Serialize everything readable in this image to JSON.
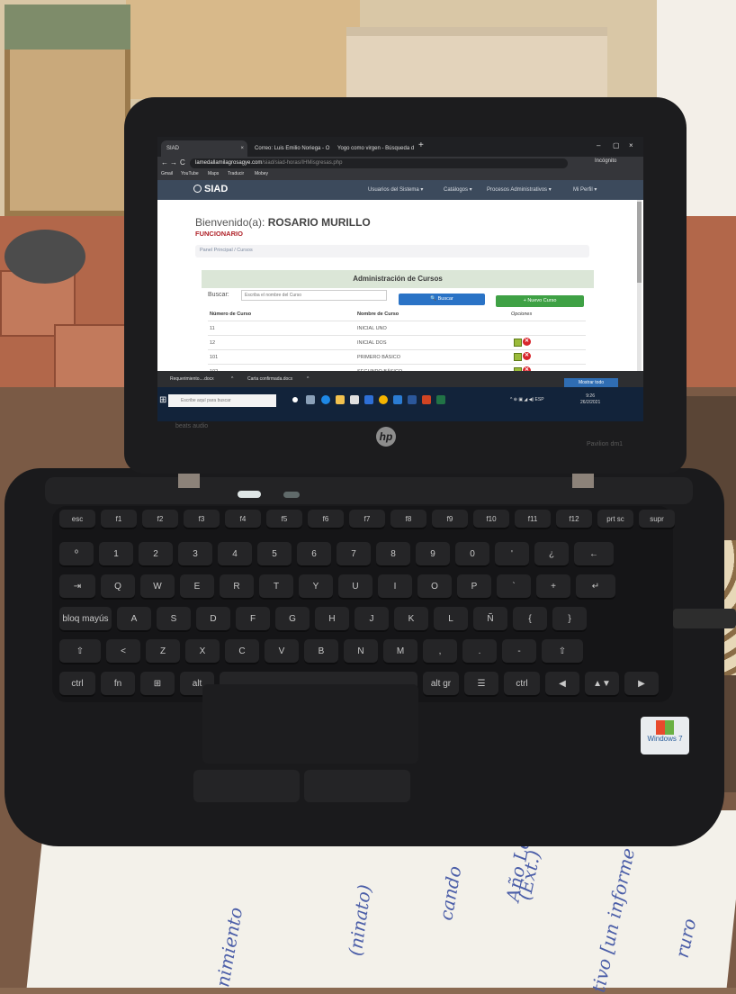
{
  "browser": {
    "tabs": [
      {
        "label": "SIAD",
        "close": "×"
      },
      {
        "label": "Correo: Luis Emilio Noriega - O",
        "close": "×"
      },
      {
        "label": "Yogo como virgen - Búsqueda d",
        "close": "×"
      }
    ],
    "new_tab": "+",
    "window_controls": {
      "minimize": "–",
      "maximize": "▢",
      "close": "×"
    },
    "nav": {
      "back": "←",
      "forward": "→",
      "reload": "C"
    },
    "url_host": "lamedallamilagrosagye.com",
    "url_path": "/siad/siad-horas/IHMisgresas.php",
    "profile_label": "Incógnito",
    "bookmarks": [
      "Gmail",
      "YouTube",
      "Maps",
      "Traducir",
      "Mobey"
    ]
  },
  "site": {
    "brand": "SIAD",
    "menu": [
      "Usuarios del Sistema ▾",
      "Catálogos ▾",
      "Procesos Administrativos ▾",
      "Mi Perfil ▾"
    ],
    "welcome_prefix": "Bienvenido(a):",
    "user_name": "ROSARIO MURILLO",
    "role": "FUNCIONARIO",
    "breadcrumb": "Panel Principal / Cursos",
    "panel_title": "Administración de Cursos",
    "search_label": "Buscar:",
    "search_placeholder": "Escriba el nombre del Curso",
    "search_button": "🔍 Buscar",
    "new_button": "+ Nuevo Curso",
    "columns": [
      "Número de Curso",
      "Nombre de Curso",
      "Opciones"
    ],
    "rows": [
      {
        "num": "11",
        "name": "INICIAL UNO"
      },
      {
        "num": "12",
        "name": "INICIAL DOS"
      },
      {
        "num": "101",
        "name": "PRIMERO BÁSICO"
      },
      {
        "num": "102",
        "name": "SEGUNDO BÁSICO"
      }
    ],
    "delete_glyph": "✕"
  },
  "downloads": [
    {
      "label": "Requerimiento....docx",
      "caret": "^"
    },
    {
      "label": "Carta confirmada.docx",
      "caret": "^"
    }
  ],
  "taskbar": {
    "start": "⊞",
    "search_placeholder": "Escribe aquí para buscar",
    "tray": "^ ⊕ ▣ ◢ ◀) ESP",
    "time": "9:26",
    "date": "26/2/2021",
    "notification": "Mostrar todo"
  },
  "laptop": {
    "logo": "hp",
    "lid_left_text": "beats audio",
    "lid_right_text": "Pavilion dm1",
    "sticker": "Windows 7"
  },
  "keyboard": {
    "rows": [
      [
        "esc",
        "f1",
        "f2",
        "f3",
        "f4",
        "f5",
        "f6",
        "f7",
        "f8",
        "f9",
        "f10",
        "f11",
        "f12",
        "prt sc",
        "supr"
      ],
      [
        "º",
        "1",
        "2",
        "3",
        "4",
        "5",
        "6",
        "7",
        "8",
        "9",
        "0",
        "'",
        "¿",
        "←"
      ],
      [
        "⇥",
        "Q",
        "W",
        "E",
        "R",
        "T",
        "Y",
        "U",
        "I",
        "O",
        "P",
        "`",
        "+",
        "↵"
      ],
      [
        "bloq mayús",
        "A",
        "S",
        "D",
        "F",
        "G",
        "H",
        "J",
        "K",
        "L",
        "Ñ",
        "{",
        "}"
      ],
      [
        "⇧",
        "<",
        "Z",
        "X",
        "C",
        "V",
        "B",
        "N",
        "M",
        ",",
        ".",
        "-",
        "⇧"
      ],
      [
        "ctrl",
        "fn",
        "⊞",
        "alt",
        "",
        "alt gr",
        "☰",
        "ctrl",
        "◀",
        "▲▼",
        "▶"
      ]
    ]
  },
  "handwriting": [
    "Año Lectivo",
    "(Ext.)",
    "tivo [un informe",
    "nimiento",
    "(ninato)",
    "cando",
    "ruro"
  ]
}
